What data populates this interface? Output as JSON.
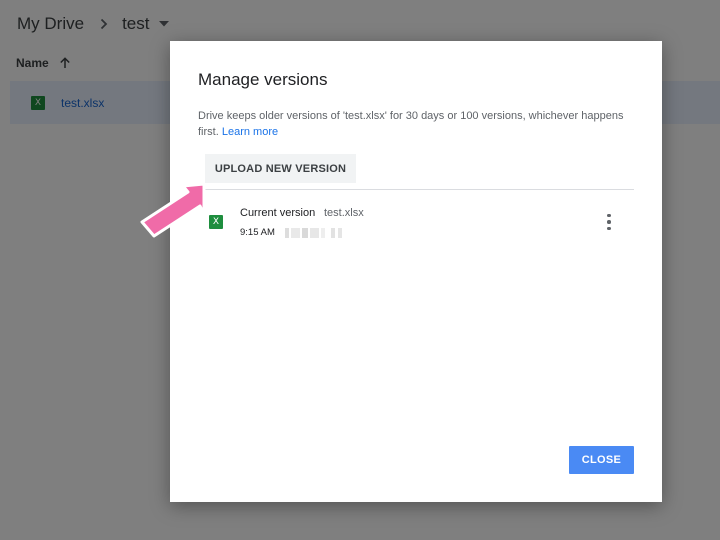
{
  "breadcrumb": {
    "root": "My Drive",
    "folder": "test"
  },
  "file_list": {
    "column_name": "Name",
    "rows": [
      {
        "icon_letter": "X",
        "name": "test.xlsx"
      }
    ]
  },
  "dialog": {
    "title": "Manage versions",
    "description": "Drive keeps older versions of 'test.xlsx' for 30 days or 100 versions, whichever happens first.",
    "learn_more": "Learn more",
    "upload_button": "UPLOAD NEW VERSION",
    "versions": [
      {
        "icon_letter": "X",
        "label": "Current version",
        "file": "test.xlsx",
        "time": "9:15 AM"
      }
    ],
    "close_button": "CLOSE"
  },
  "colors": {
    "accent_blue": "#4a8af4",
    "link_blue": "#1a73e8",
    "excel_green": "#1e8e3e",
    "selected_row": "#e8f0fe",
    "pointer_pink": "#f06ba8"
  },
  "icons": {
    "breadcrumb_separator": "chevron-right-icon",
    "folder_menu": "caret-down-icon",
    "sort": "arrow-up-icon",
    "file_type": "excel-icon",
    "version_menu": "more-vertical-icon",
    "annotation": "pink-pointer-arrow"
  }
}
